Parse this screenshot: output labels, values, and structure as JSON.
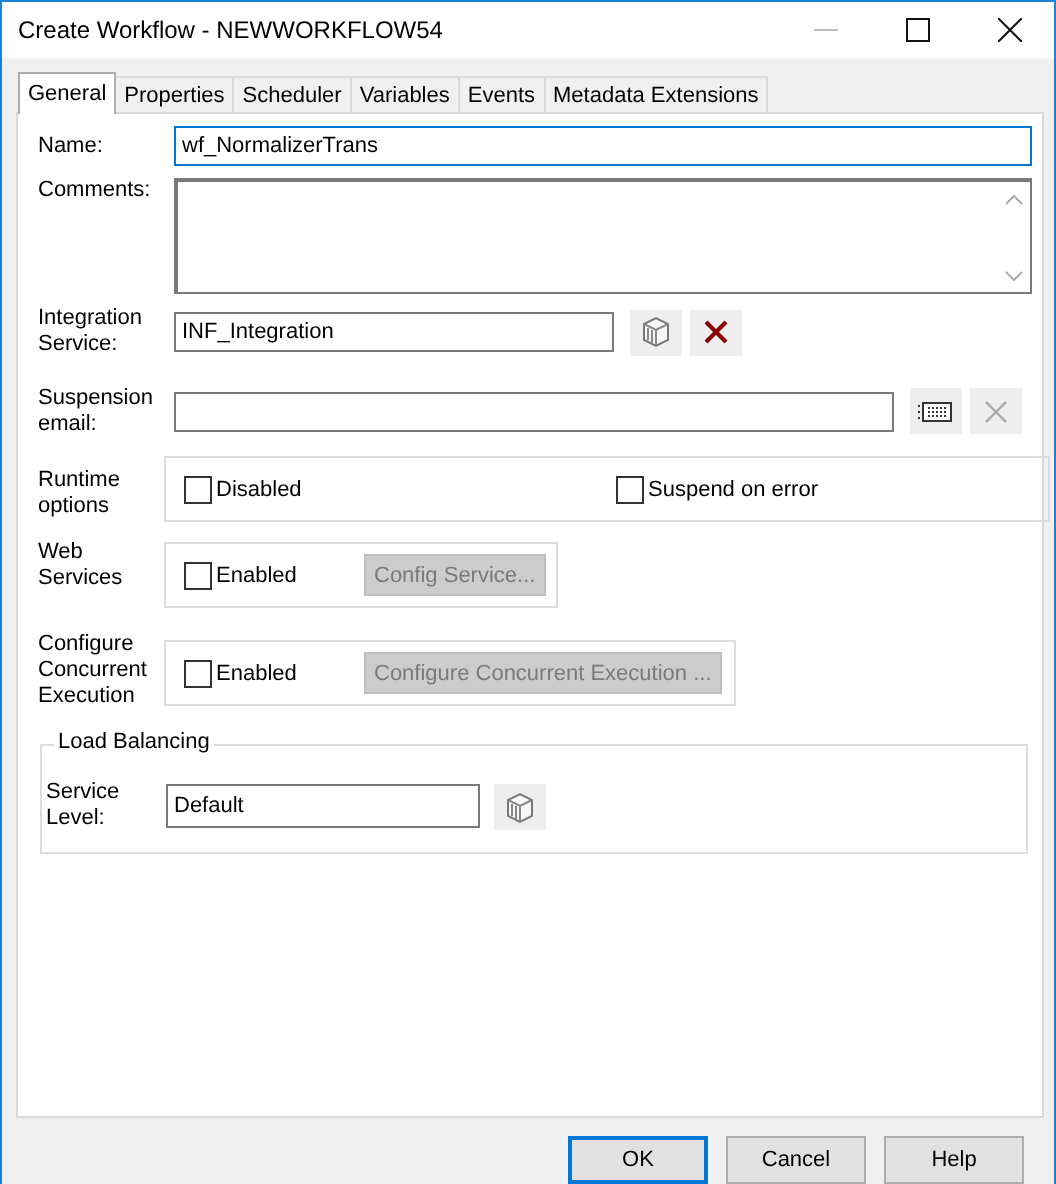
{
  "window": {
    "title": "Create Workflow - NEWWORKFLOW54"
  },
  "tabs": [
    {
      "label": "General",
      "selected": true
    },
    {
      "label": "Properties",
      "selected": false
    },
    {
      "label": "Scheduler",
      "selected": false
    },
    {
      "label": "Variables",
      "selected": false
    },
    {
      "label": "Events",
      "selected": false
    },
    {
      "label": "Metadata Extensions",
      "selected": false
    }
  ],
  "name": {
    "label": "Name:",
    "value": "wf_NormalizerTrans",
    "focused": true
  },
  "comments": {
    "label": "Comments:"
  },
  "integration_service": {
    "label": "Integration Service:",
    "value": "INF_Integration",
    "clear_disabled": false
  },
  "suspension_email": {
    "label": "Suspension email:",
    "clear_disabled": true
  },
  "runtime_options": {
    "label": "Runtime options",
    "options": [
      {
        "label": "Disabled",
        "checked": false
      },
      {
        "label": "Suspend on error",
        "checked": false
      }
    ]
  },
  "web_services": {
    "label": "Web Services",
    "enabled": {
      "label": "Enabled",
      "checked": false
    },
    "button": {
      "label": "Config Service...",
      "disabled": true
    }
  },
  "concurrent_execution": {
    "label": "Configure Concurrent Execution",
    "enabled": {
      "label": "Enabled",
      "checked": false
    },
    "button": {
      "label": "Configure Concurrent Execution ...",
      "disabled": true
    }
  },
  "load_balancing": {
    "title": "Load Balancing",
    "service_level": {
      "label": "Service Level:",
      "value": "Default"
    }
  },
  "buttons": [
    {
      "label": "OK",
      "default": true
    },
    {
      "label": "Cancel",
      "default": false
    },
    {
      "label": "Help",
      "default": false
    }
  ]
}
